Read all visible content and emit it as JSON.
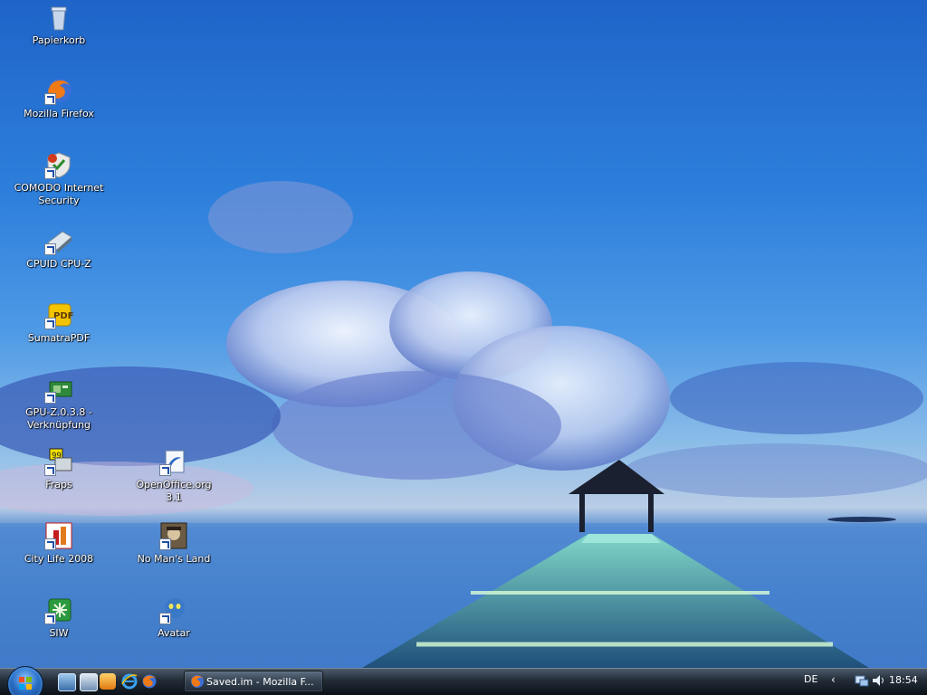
{
  "desktop": {
    "icons": [
      {
        "label": "Papierkorb",
        "icon": "recycle-bin-icon",
        "shortcut": false
      },
      {
        "label": "Mozilla Firefox",
        "icon": "firefox-icon",
        "shortcut": true
      },
      {
        "label": "COMODO Internet\nSecurity",
        "icon": "comodo-icon",
        "shortcut": true
      },
      {
        "label": "CPUID CPU-Z",
        "icon": "cpuz-icon",
        "shortcut": true
      },
      {
        "label": "SumatraPDF",
        "icon": "pdf-icon",
        "shortcut": true
      },
      {
        "label": "GPU-Z.0.3.8 -\nVerknüpfung",
        "icon": "gpuz-icon",
        "shortcut": true
      },
      {
        "label": "Fraps",
        "icon": "fraps-icon",
        "shortcut": true
      },
      {
        "label": "OpenOffice.org 3.1",
        "icon": "openoffice-icon",
        "shortcut": true
      },
      {
        "label": "City Life 2008",
        "icon": "citylife-icon",
        "shortcut": true
      },
      {
        "label": "No Man's Land",
        "icon": "nomansland-icon",
        "shortcut": true
      },
      {
        "label": "SIW",
        "icon": "siw-icon",
        "shortcut": true
      },
      {
        "label": "Avatar",
        "icon": "avatar-icon",
        "shortcut": true
      }
    ]
  },
  "taskbar": {
    "start_icon": "windows-orb-icon",
    "quick_launch": [
      "show-desktop-icon",
      "switch-windows-icon",
      "media-player-icon",
      "internet-explorer-icon",
      "firefox-icon"
    ],
    "task_button_label": "Saved.im - Mozilla F...",
    "language": "DE",
    "tray_chevron": "‹",
    "tray_icons": [
      "network-icon",
      "volume-icon"
    ],
    "clock": "18:54"
  },
  "colors": {
    "sky_top": "#1f64c8",
    "sea": "#3f7ac9",
    "taskbar": "#222b36"
  }
}
